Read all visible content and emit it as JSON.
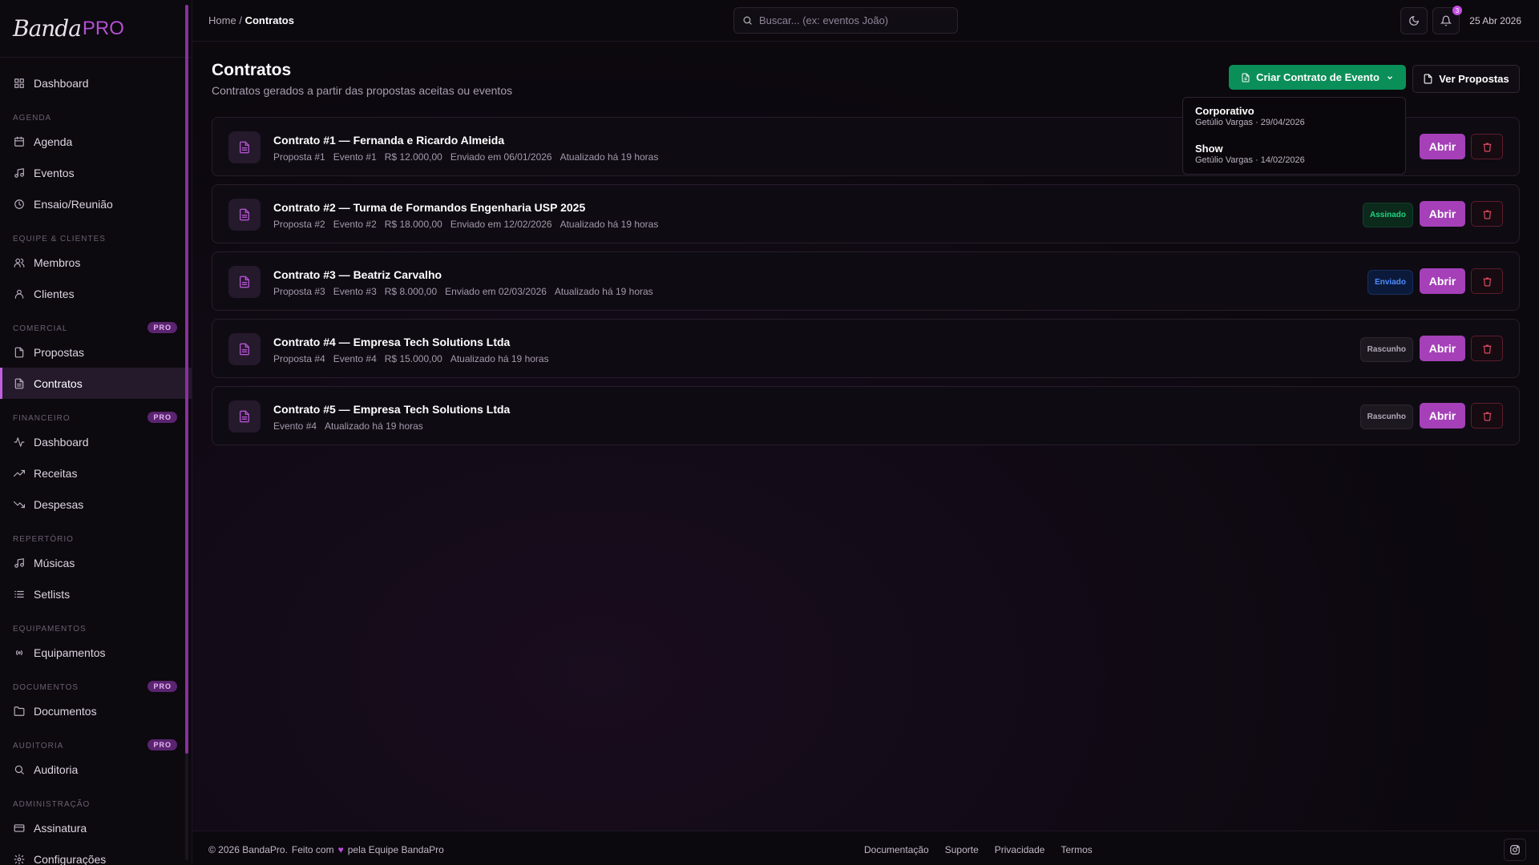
{
  "brand": {
    "name_script": "Banda",
    "name_pro": "PRO"
  },
  "sidebar": {
    "groups": [
      {
        "label": "",
        "pro": "",
        "items": [
          {
            "label": "Dashboard",
            "icon": "dashboard-icon"
          }
        ]
      },
      {
        "label": "AGENDA",
        "pro": "",
        "items": [
          {
            "label": "Agenda",
            "icon": "calendar-icon"
          },
          {
            "label": "Eventos",
            "icon": "music-icon"
          },
          {
            "label": "Ensaio/Reunião",
            "icon": "clock-icon"
          }
        ]
      },
      {
        "label": "EQUIPE & CLIENTES",
        "pro": "",
        "items": [
          {
            "label": "Membros",
            "icon": "users-icon"
          },
          {
            "label": "Clientes",
            "icon": "user-icon"
          }
        ]
      },
      {
        "label": "COMERCIAL",
        "pro": "PRO",
        "items": [
          {
            "label": "Propostas",
            "icon": "file-icon"
          },
          {
            "label": "Contratos",
            "icon": "file-text-icon",
            "active": true
          }
        ]
      },
      {
        "label": "FINANCEIRO",
        "pro": "PRO",
        "items": [
          {
            "label": "Dashboard",
            "icon": "activity-icon"
          },
          {
            "label": "Receitas",
            "icon": "trending-up-icon"
          },
          {
            "label": "Despesas",
            "icon": "trending-down-icon"
          }
        ]
      },
      {
        "label": "REPERTÓRIO",
        "pro": "",
        "items": [
          {
            "label": "Músicas",
            "icon": "music-icon"
          },
          {
            "label": "Setlists",
            "icon": "list-icon"
          }
        ]
      },
      {
        "label": "EQUIPAMENTOS",
        "pro": "",
        "items": [
          {
            "label": "Equipamentos",
            "icon": "radio-icon"
          }
        ]
      },
      {
        "label": "DOCUMENTOS",
        "pro": "PRO",
        "items": [
          {
            "label": "Documentos",
            "icon": "folder-icon"
          }
        ]
      },
      {
        "label": "AUDITORIA",
        "pro": "PRO",
        "items": [
          {
            "label": "Auditoria",
            "icon": "search-icon"
          }
        ]
      },
      {
        "label": "ADMINISTRAÇÃO",
        "pro": "",
        "items": [
          {
            "label": "Assinatura",
            "icon": "credit-card-icon"
          },
          {
            "label": "Configurações",
            "icon": "gear-icon"
          }
        ]
      }
    ]
  },
  "topbar": {
    "breadcrumb_home": "Home",
    "breadcrumb_sep": "/",
    "breadcrumb_current": "Contratos",
    "search_placeholder": "Buscar... (ex: eventos João)",
    "notification_count": "3",
    "date": "25 Abr 2026"
  },
  "page": {
    "title": "Contratos",
    "subtitle": "Contratos gerados a partir das propostas aceitas ou eventos",
    "create_button": "Criar Contrato de Evento",
    "proposals_button": "Ver Propostas"
  },
  "dropdown": [
    {
      "type": "Corporativo",
      "client": "Getúlio Vargas",
      "date": "29/04/2026"
    },
    {
      "type": "Show",
      "client": "Getúlio Vargas",
      "date": "14/02/2026"
    }
  ],
  "contracts": [
    {
      "title": "Contrato #1 — Fernanda e Ricardo Almeida",
      "meta": [
        "Proposta #1",
        "Evento #1",
        "R$ 12.000,00",
        "Enviado em 06/01/2026",
        "Atualizado há 19 horas"
      ],
      "status": "",
      "status_class": "st-assinado"
    },
    {
      "title": "Contrato #2 — Turma de Formandos Engenharia USP 2025",
      "meta": [
        "Proposta #2",
        "Evento #2",
        "R$ 18.000,00",
        "Enviado em 12/02/2026",
        "Atualizado há 19 horas"
      ],
      "status": "Assinado",
      "status_class": "st-assinado"
    },
    {
      "title": "Contrato #3 — Beatriz Carvalho",
      "meta": [
        "Proposta #3",
        "Evento #3",
        "R$ 8.000,00",
        "Enviado em 02/03/2026",
        "Atualizado há 19 horas"
      ],
      "status": "Enviado",
      "status_class": "st-enviado"
    },
    {
      "title": "Contrato #4 — Empresa Tech Solutions Ltda",
      "meta": [
        "Proposta #4",
        "Evento #4",
        "R$ 15.000,00",
        "Atualizado há 19 horas"
      ],
      "status": "Rascunho",
      "status_class": "st-rascunho"
    },
    {
      "title": "Contrato #5 — Empresa Tech Solutions Ltda",
      "meta": [
        "Evento #4",
        "Atualizado há 19 horas"
      ],
      "status": "Rascunho",
      "status_class": "st-rascunho"
    }
  ],
  "actions": {
    "open_label": "Abrir"
  },
  "footer": {
    "copyright": "© 2026 BandaPro.",
    "made_with": "Feito com",
    "by_team": "pela Equipe BandaPro",
    "links": [
      "Documentação",
      "Suporte",
      "Privacidade",
      "Termos"
    ]
  },
  "colors": {
    "accent": "#a540b8",
    "green": "#0b8f58",
    "danger": "#ef5168",
    "background": "#0b080e"
  }
}
